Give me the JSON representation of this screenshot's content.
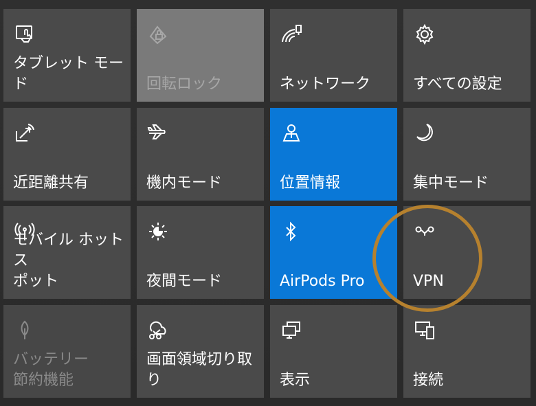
{
  "tiles": [
    {
      "label": "タブレット モード",
      "icon": "tablet-mode-icon",
      "state": "inactive"
    },
    {
      "label": "回転ロック",
      "icon": "rotation-lock-icon",
      "state": "disabled"
    },
    {
      "label": "ネットワーク",
      "icon": "network-icon",
      "state": "inactive"
    },
    {
      "label": "すべての設定",
      "icon": "gear-icon",
      "state": "inactive"
    },
    {
      "label": "近距離共有",
      "icon": "nearby-share-icon",
      "state": "inactive"
    },
    {
      "label": "機内モード",
      "icon": "airplane-icon",
      "state": "inactive"
    },
    {
      "label": "位置情報",
      "icon": "location-icon",
      "state": "active"
    },
    {
      "label": "集中モード",
      "icon": "moon-icon",
      "state": "inactive"
    },
    {
      "label": "モバイル ホットス\nポット",
      "icon": "hotspot-icon",
      "state": "inactive"
    },
    {
      "label": "夜間モード",
      "icon": "night-light-icon",
      "state": "inactive"
    },
    {
      "label": "AirPods Pro",
      "icon": "bluetooth-icon",
      "state": "active"
    },
    {
      "label": "VPN",
      "icon": "vpn-icon",
      "state": "inactive"
    },
    {
      "label": "バッテリー\n節約機能",
      "icon": "battery-saver-icon",
      "state": "disabled"
    },
    {
      "label": "画面領域切り取\nり",
      "icon": "snip-icon",
      "state": "inactive"
    },
    {
      "label": "表示",
      "icon": "project-icon",
      "state": "inactive"
    },
    {
      "label": "接続",
      "icon": "connect-icon",
      "state": "inactive"
    }
  ],
  "colors": {
    "tile": "#4a4a4a",
    "active": "#0a78d7",
    "highlight": "#b6812e"
  }
}
